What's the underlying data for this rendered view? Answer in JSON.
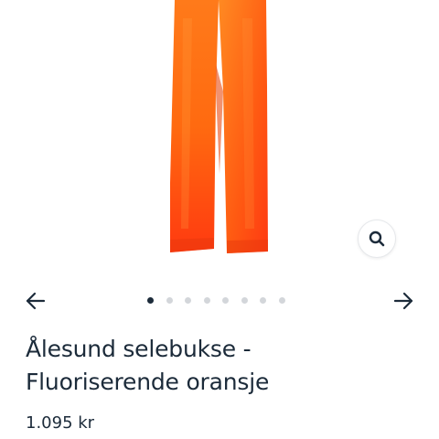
{
  "product": {
    "title_line1": "Ålesund selebukse -",
    "title_line2": "Fluoriserende oransje",
    "price": "1.095 kr",
    "color": "#ff5a14"
  },
  "gallery": {
    "image_count": 8,
    "active_index": 0,
    "icons": {
      "prev": "arrow-left-icon",
      "next": "arrow-right-icon",
      "zoom": "magnifier-icon"
    }
  }
}
